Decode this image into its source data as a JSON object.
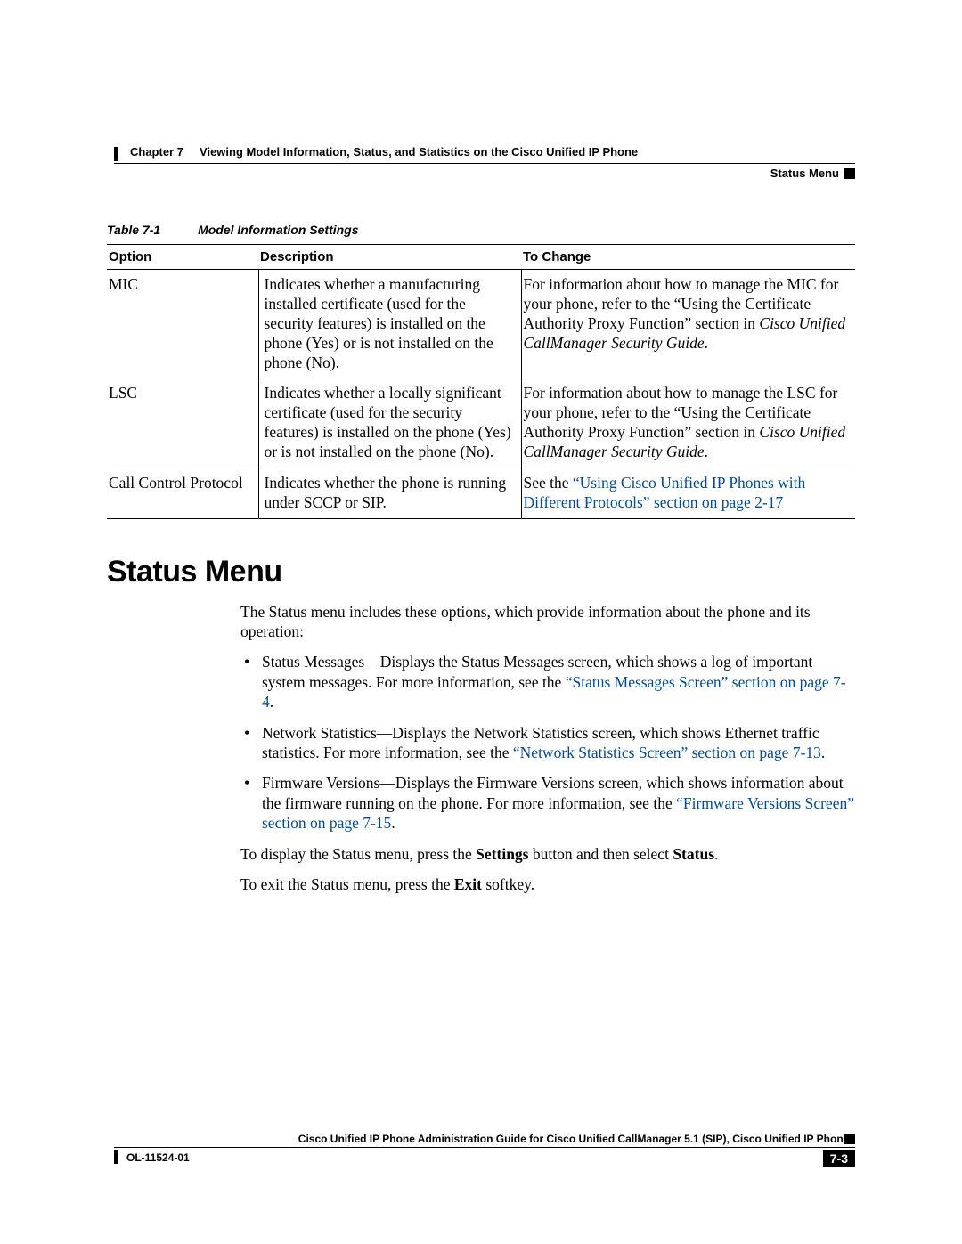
{
  "header": {
    "chapter_label": "Chapter 7",
    "chapter_title": "Viewing Model Information, Status, and Statistics on the Cisco Unified IP Phone",
    "section_title": "Status Menu"
  },
  "table_caption": {
    "label": "Table 7-1",
    "title": "Model Information Settings"
  },
  "table_headers": {
    "option": "Option",
    "description": "Description",
    "to_change": "To Change"
  },
  "rows": [
    {
      "option": "MIC",
      "description": "Indicates whether a manufacturing installed certificate (used for the security features) is installed on the phone (Yes) or is not installed on the phone (No).",
      "change_pre": "For information about how to manage the MIC for your phone, refer to the “Using the Certificate Authority Proxy Function” section in ",
      "change_it1": "Cisco Unified CallManager Security Guide",
      "change_post": "."
    },
    {
      "option": "LSC",
      "description": "Indicates whether a locally significant certificate (used for the security features) is installed on the phone (Yes) or is not installed on the phone (No).",
      "change_pre": "For information about how to manage the LSC for your phone, refer to the “Using the Certificate Authority Proxy Function” section in ",
      "change_it1": "Cisco Unified CallManager Security Guide",
      "change_post": "."
    },
    {
      "option": "Call Control Protocol",
      "description": "Indicates whether the phone is running under SCCP or SIP.",
      "change_pre": "See the ",
      "change_link": "“Using Cisco Unified IP Phones with Different Protocols” section on page 2-17"
    }
  ],
  "section_heading": "Status Menu",
  "intro": "The Status menu includes these options, which provide information about the phone and its operation:",
  "bullets": [
    {
      "pre": "Status Messages—Displays the Status Messages screen, which shows a log of important system messages. For more information, see the ",
      "link": "“Status Messages Screen” section on page 7-4",
      "post": "."
    },
    {
      "pre": "Network Statistics—Displays the Network Statistics screen, which shows Ethernet traffic statistics. For more information, see the ",
      "link": "“Network Statistics Screen” section on page 7-13",
      "post": "."
    },
    {
      "pre": "Firmware Versions—Displays the Firmware Versions screen, which shows information about the firmware running on the phone. For more information, see the ",
      "link": "“Firmware Versions Screen” section on page 7-15",
      "post": "."
    }
  ],
  "para_display_pre": "To display the Status menu, press the ",
  "para_display_b1": "Settings",
  "para_display_mid": " button and then select ",
  "para_display_b2": "Status",
  "para_display_post": ".",
  "para_exit_pre": "To exit the Status menu, press the ",
  "para_exit_b1": "Exit",
  "para_exit_post": " softkey.",
  "footer": {
    "guide": "Cisco Unified IP Phone Administration Guide for Cisco Unified CallManager 5.1 (SIP), Cisco Unified IP Phones",
    "doc_id": "OL-11524-01",
    "page": "7-3"
  }
}
